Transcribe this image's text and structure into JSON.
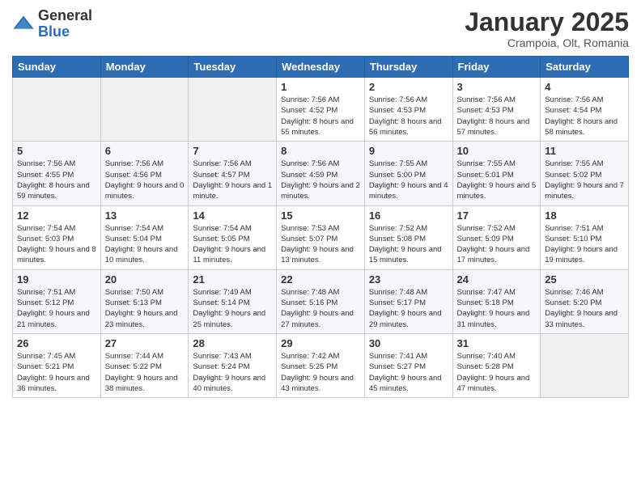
{
  "logo": {
    "general": "General",
    "blue": "Blue"
  },
  "title": "January 2025",
  "location": "Crampoia, Olt, Romania",
  "days_header": [
    "Sunday",
    "Monday",
    "Tuesday",
    "Wednesday",
    "Thursday",
    "Friday",
    "Saturday"
  ],
  "weeks": [
    [
      {
        "day": "",
        "sunrise": "",
        "sunset": "",
        "daylight": ""
      },
      {
        "day": "",
        "sunrise": "",
        "sunset": "",
        "daylight": ""
      },
      {
        "day": "",
        "sunrise": "",
        "sunset": "",
        "daylight": ""
      },
      {
        "day": "1",
        "sunrise": "Sunrise: 7:56 AM",
        "sunset": "Sunset: 4:52 PM",
        "daylight": "Daylight: 8 hours and 55 minutes."
      },
      {
        "day": "2",
        "sunrise": "Sunrise: 7:56 AM",
        "sunset": "Sunset: 4:53 PM",
        "daylight": "Daylight: 8 hours and 56 minutes."
      },
      {
        "day": "3",
        "sunrise": "Sunrise: 7:56 AM",
        "sunset": "Sunset: 4:53 PM",
        "daylight": "Daylight: 8 hours and 57 minutes."
      },
      {
        "day": "4",
        "sunrise": "Sunrise: 7:56 AM",
        "sunset": "Sunset: 4:54 PM",
        "daylight": "Daylight: 8 hours and 58 minutes."
      }
    ],
    [
      {
        "day": "5",
        "sunrise": "Sunrise: 7:56 AM",
        "sunset": "Sunset: 4:55 PM",
        "daylight": "Daylight: 8 hours and 59 minutes."
      },
      {
        "day": "6",
        "sunrise": "Sunrise: 7:56 AM",
        "sunset": "Sunset: 4:56 PM",
        "daylight": "Daylight: 9 hours and 0 minutes."
      },
      {
        "day": "7",
        "sunrise": "Sunrise: 7:56 AM",
        "sunset": "Sunset: 4:57 PM",
        "daylight": "Daylight: 9 hours and 1 minute."
      },
      {
        "day": "8",
        "sunrise": "Sunrise: 7:56 AM",
        "sunset": "Sunset: 4:59 PM",
        "daylight": "Daylight: 9 hours and 2 minutes."
      },
      {
        "day": "9",
        "sunrise": "Sunrise: 7:55 AM",
        "sunset": "Sunset: 5:00 PM",
        "daylight": "Daylight: 9 hours and 4 minutes."
      },
      {
        "day": "10",
        "sunrise": "Sunrise: 7:55 AM",
        "sunset": "Sunset: 5:01 PM",
        "daylight": "Daylight: 9 hours and 5 minutes."
      },
      {
        "day": "11",
        "sunrise": "Sunrise: 7:55 AM",
        "sunset": "Sunset: 5:02 PM",
        "daylight": "Daylight: 9 hours and 7 minutes."
      }
    ],
    [
      {
        "day": "12",
        "sunrise": "Sunrise: 7:54 AM",
        "sunset": "Sunset: 5:03 PM",
        "daylight": "Daylight: 9 hours and 8 minutes."
      },
      {
        "day": "13",
        "sunrise": "Sunrise: 7:54 AM",
        "sunset": "Sunset: 5:04 PM",
        "daylight": "Daylight: 9 hours and 10 minutes."
      },
      {
        "day": "14",
        "sunrise": "Sunrise: 7:54 AM",
        "sunset": "Sunset: 5:05 PM",
        "daylight": "Daylight: 9 hours and 11 minutes."
      },
      {
        "day": "15",
        "sunrise": "Sunrise: 7:53 AM",
        "sunset": "Sunset: 5:07 PM",
        "daylight": "Daylight: 9 hours and 13 minutes."
      },
      {
        "day": "16",
        "sunrise": "Sunrise: 7:52 AM",
        "sunset": "Sunset: 5:08 PM",
        "daylight": "Daylight: 9 hours and 15 minutes."
      },
      {
        "day": "17",
        "sunrise": "Sunrise: 7:52 AM",
        "sunset": "Sunset: 5:09 PM",
        "daylight": "Daylight: 9 hours and 17 minutes."
      },
      {
        "day": "18",
        "sunrise": "Sunrise: 7:51 AM",
        "sunset": "Sunset: 5:10 PM",
        "daylight": "Daylight: 9 hours and 19 minutes."
      }
    ],
    [
      {
        "day": "19",
        "sunrise": "Sunrise: 7:51 AM",
        "sunset": "Sunset: 5:12 PM",
        "daylight": "Daylight: 9 hours and 21 minutes."
      },
      {
        "day": "20",
        "sunrise": "Sunrise: 7:50 AM",
        "sunset": "Sunset: 5:13 PM",
        "daylight": "Daylight: 9 hours and 23 minutes."
      },
      {
        "day": "21",
        "sunrise": "Sunrise: 7:49 AM",
        "sunset": "Sunset: 5:14 PM",
        "daylight": "Daylight: 9 hours and 25 minutes."
      },
      {
        "day": "22",
        "sunrise": "Sunrise: 7:48 AM",
        "sunset": "Sunset: 5:16 PM",
        "daylight": "Daylight: 9 hours and 27 minutes."
      },
      {
        "day": "23",
        "sunrise": "Sunrise: 7:48 AM",
        "sunset": "Sunset: 5:17 PM",
        "daylight": "Daylight: 9 hours and 29 minutes."
      },
      {
        "day": "24",
        "sunrise": "Sunrise: 7:47 AM",
        "sunset": "Sunset: 5:18 PM",
        "daylight": "Daylight: 9 hours and 31 minutes."
      },
      {
        "day": "25",
        "sunrise": "Sunrise: 7:46 AM",
        "sunset": "Sunset: 5:20 PM",
        "daylight": "Daylight: 9 hours and 33 minutes."
      }
    ],
    [
      {
        "day": "26",
        "sunrise": "Sunrise: 7:45 AM",
        "sunset": "Sunset: 5:21 PM",
        "daylight": "Daylight: 9 hours and 36 minutes."
      },
      {
        "day": "27",
        "sunrise": "Sunrise: 7:44 AM",
        "sunset": "Sunset: 5:22 PM",
        "daylight": "Daylight: 9 hours and 38 minutes."
      },
      {
        "day": "28",
        "sunrise": "Sunrise: 7:43 AM",
        "sunset": "Sunset: 5:24 PM",
        "daylight": "Daylight: 9 hours and 40 minutes."
      },
      {
        "day": "29",
        "sunrise": "Sunrise: 7:42 AM",
        "sunset": "Sunset: 5:25 PM",
        "daylight": "Daylight: 9 hours and 43 minutes."
      },
      {
        "day": "30",
        "sunrise": "Sunrise: 7:41 AM",
        "sunset": "Sunset: 5:27 PM",
        "daylight": "Daylight: 9 hours and 45 minutes."
      },
      {
        "day": "31",
        "sunrise": "Sunrise: 7:40 AM",
        "sunset": "Sunset: 5:28 PM",
        "daylight": "Daylight: 9 hours and 47 minutes."
      },
      {
        "day": "",
        "sunrise": "",
        "sunset": "",
        "daylight": ""
      }
    ]
  ]
}
